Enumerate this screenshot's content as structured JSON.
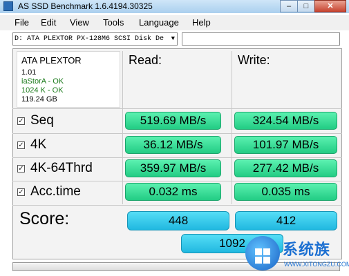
{
  "window": {
    "title": "AS SSD Benchmark 1.6.4194.30325",
    "minimize": "–",
    "maximize": "□",
    "close": "✕"
  },
  "menu": [
    "File",
    "Edit",
    "View",
    "Tools",
    "Language",
    "Help"
  ],
  "drive_select": {
    "value": "D: ATA PLEXTOR PX-128M6 SCSI Disk De",
    "arrow": "▼"
  },
  "drive_info": {
    "model": "ATA PLEXTOR",
    "firmware": "1.01",
    "driver": "iaStorA - OK",
    "alignment": "1024 K - OK",
    "size": "119.24 GB",
    "ok_color": "#1a7a1a"
  },
  "headers": {
    "read": "Read:",
    "write": "Write:"
  },
  "tests": [
    {
      "label": "Seq",
      "checked": "✓",
      "read": "519.69 MB/s",
      "write": "324.54 MB/s"
    },
    {
      "label": "4K",
      "checked": "✓",
      "read": "36.12 MB/s",
      "write": "101.97 MB/s"
    },
    {
      "label": "4K-64Thrd",
      "checked": "✓",
      "read": "359.97 MB/s",
      "write": "277.42 MB/s"
    },
    {
      "label": "Acc.time",
      "checked": "✓",
      "read": "0.032 ms",
      "write": "0.035 ms"
    }
  ],
  "score": {
    "label": "Score:",
    "read": "448",
    "write": "412",
    "total": "1092"
  },
  "watermark": {
    "text": "系统族",
    "url": "WWW.XITONGZU.COM"
  }
}
